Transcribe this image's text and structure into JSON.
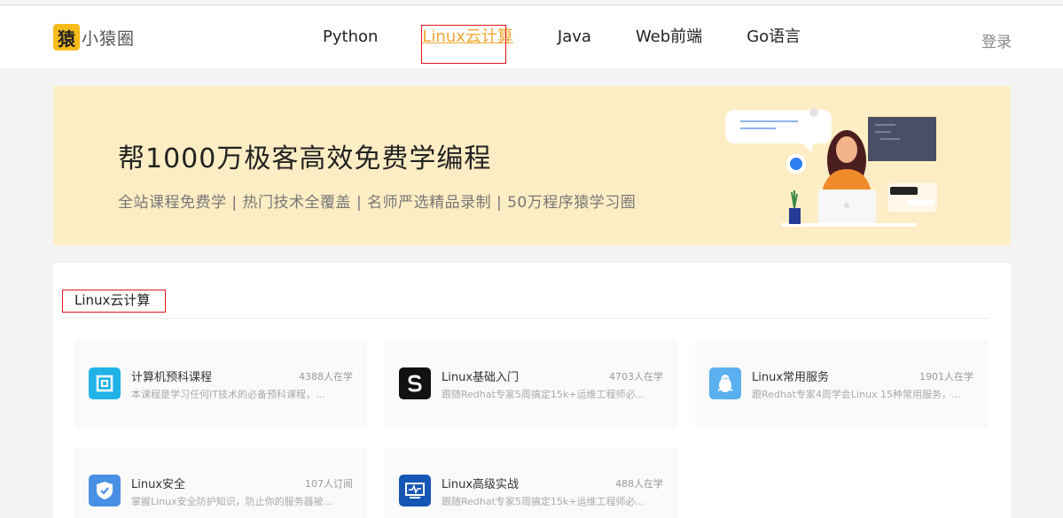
{
  "header": {
    "logo_mark": "猿",
    "logo_text": "小猿圈",
    "nav": [
      {
        "label": "Python"
      },
      {
        "label": "Linux云计算"
      },
      {
        "label": "Java"
      },
      {
        "label": "Web前端"
      },
      {
        "label": "Go语言"
      }
    ],
    "active_nav": "Linux云计算",
    "login": "登录"
  },
  "banner": {
    "title": "帮1000万极客高效免费学编程",
    "subtitle": "全站课程免费学 | 热门技术全覆盖 | 名师严选精品录制 | 50万程序猿学习圈"
  },
  "section": {
    "title": "Linux云计算",
    "courses": [
      {
        "title": "计算机预科课程",
        "count": "4388人在学",
        "desc": "本课程是学习任何IT技术的必备预科课程，...",
        "icon": "preparatory-icon",
        "color": "#1fb3e8"
      },
      {
        "title": "Linux基础入门",
        "count": "4703人在学",
        "desc": "跟随Redhat专家5周搞定15k+运维工程师必...",
        "icon": "letter-s-icon",
        "color": "#111111"
      },
      {
        "title": "Linux常用服务",
        "count": "1901人在学",
        "desc": "跟Redhat专家4周学会Linux 15种常用服务，...",
        "icon": "penguin-icon",
        "color": "#5ab0ee"
      },
      {
        "title": "Linux安全",
        "count": "107人订阅",
        "desc": "掌握Linux安全防护知识，防止你的服务器被...",
        "icon": "shield-check-icon",
        "color": "#4a8fe6"
      },
      {
        "title": "Linux高级实战",
        "count": "488人在学",
        "desc": "跟随Redhat专家5周搞定15k+运维工程师必...",
        "icon": "monitor-pulse-icon",
        "color": "#1656b5"
      }
    ]
  }
}
